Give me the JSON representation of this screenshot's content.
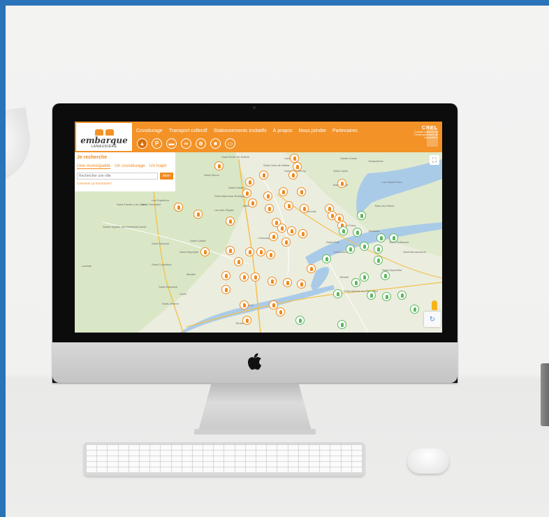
{
  "site": {
    "logo_word": "embarque",
    "logo_sub": "LANAUDIÈRE"
  },
  "nav": [
    "Covoiturage",
    "Transport collectif",
    "Stationnements incitatifs",
    "À propos",
    "Nous joindre",
    "Partenaires"
  ],
  "categories": [
    {
      "icon": "carpool-pin-icon",
      "glyph": "▲",
      "active": true
    },
    {
      "icon": "parking-icon",
      "glyph": "P",
      "active": false
    },
    {
      "icon": "bus-icon",
      "glyph": "▬",
      "active": false
    },
    {
      "icon": "bike-icon",
      "glyph": "∞",
      "active": false
    },
    {
      "icon": "bike-share-icon",
      "glyph": "⊗",
      "active": false
    },
    {
      "icon": "car-icon",
      "glyph": "■",
      "active": false
    },
    {
      "icon": "taxi-icon",
      "glyph": "▭",
      "active": false
    }
  ],
  "partner": {
    "name": "CREL",
    "subtitle": "Conseil régional de l'environnement de Lanaudière"
  },
  "search_panel": {
    "title": "Je recherche",
    "tabs": [
      "Une municipalité",
      "Un covoiturage",
      "Un trajet"
    ],
    "active_tab": 0,
    "placeholder": "Rechercher une ville",
    "button": "Aller!",
    "help_link": "Comment ça fonctionne?"
  },
  "map": {
    "places": [
      {
        "name": "Saint-Émile-de-Suffolk"
      },
      {
        "name": "Saint-Jean-de-Matha"
      },
      {
        "name": "Saint-Barthélemy"
      },
      {
        "name": "Saint-Justin"
      },
      {
        "name": "Yamachiche"
      },
      {
        "name": "Lac-Saint-Pierre"
      },
      {
        "name": "Saint-Zénon"
      },
      {
        "name": "Sainte-Ursule"
      },
      {
        "name": "Labelle"
      },
      {
        "name": "Saint-Alphonse-Rodriguez"
      },
      {
        "name": "Saint-Gabriel"
      },
      {
        "name": "Maskinongé"
      },
      {
        "name": "Baie-du-Febvre"
      },
      {
        "name": "Lac-Supérieur"
      },
      {
        "name": "Saint-Faustin-Lac-Carré"
      },
      {
        "name": "Mont-Tremblant"
      },
      {
        "name": "Joliette"
      },
      {
        "name": "Berthierville"
      },
      {
        "name": "Sorel-Tracy"
      },
      {
        "name": "Lac-des-Plages"
      },
      {
        "name": "Yamaska"
      },
      {
        "name": "Val-David"
      },
      {
        "name": "Sainte-Agathe-des-Monts"
      },
      {
        "name": "Saint-Sauveur"
      },
      {
        "name": "Saint-Calixte"
      },
      {
        "name": "L'Assomption"
      },
      {
        "name": "Saint-Hippolyte"
      },
      {
        "name": "Saint-Colomban"
      },
      {
        "name": "Mirabel"
      },
      {
        "name": "Terrebonne"
      },
      {
        "name": "Contrecoeur"
      },
      {
        "name": "Saint-Hyacinthe"
      },
      {
        "name": "Montréal"
      },
      {
        "name": "Saint-Guillaume"
      },
      {
        "name": "Saint-Bonaventure"
      },
      {
        "name": "Lachute"
      },
      {
        "name": "Saint-Eustache"
      },
      {
        "name": "Laval"
      },
      {
        "name": "Saint-Jérôme"
      },
      {
        "name": "Saint-Antoine-sur-Richelieu"
      },
      {
        "name": "Saint-Ours"
      },
      {
        "name": "Beloeil"
      }
    ],
    "orange_markers": 46,
    "green_markers": 20
  },
  "map_controls": {
    "fullscreen": "⛶",
    "recaptcha": "↻"
  }
}
